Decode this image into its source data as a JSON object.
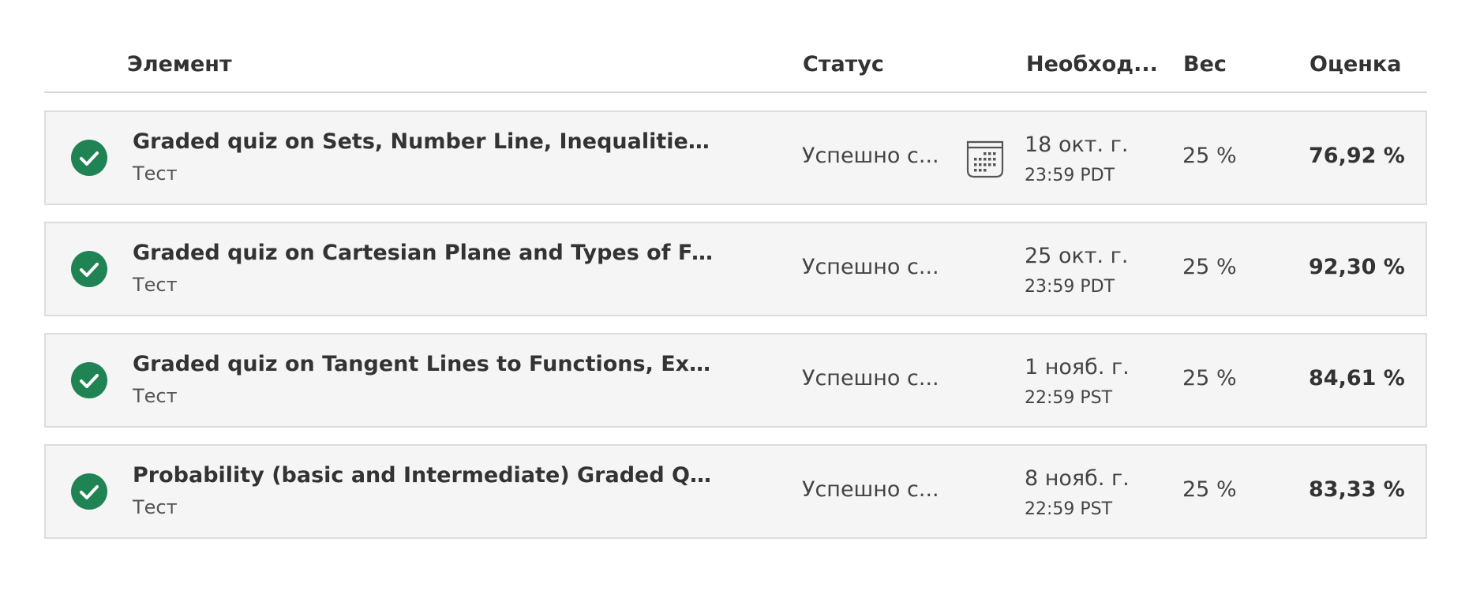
{
  "header": {
    "item": "Элемент",
    "status": "Статус",
    "due": "Необход...",
    "weight": "Вес",
    "grade": "Оценка"
  },
  "colors": {
    "check_green": "#1f8354",
    "row_bg": "#f5f5f5",
    "row_border": "#dddddd"
  },
  "rows": [
    {
      "icon": "check-circle-icon",
      "title": "Graded quiz on Sets, Number Line, Inequalities, Si...",
      "type": "Тест",
      "status": "Успешно с...",
      "calendar_icon": "calendar-icon",
      "due_date": "18 окт. г.",
      "due_time": "23:59 PDT",
      "weight": "25 %",
      "grade": "76,92 %"
    },
    {
      "icon": "check-circle-icon",
      "title": "Graded quiz on Cartesian Plane and Types of Funct...",
      "type": "Тест",
      "status": "Успешно с...",
      "due_date": "25 окт. г.",
      "due_time": "23:59 PDT",
      "weight": "25 %",
      "grade": "92,30 %"
    },
    {
      "icon": "check-circle-icon",
      "title": "Graded quiz on Tangent Lines to Functions, Expone...",
      "type": "Тест",
      "status": "Успешно с...",
      "due_date": "1 нояб. г.",
      "due_time": "22:59 PST",
      "weight": "25 %",
      "grade": "84,61 %"
    },
    {
      "icon": "check-circle-icon",
      "title": "Probability (basic and Intermediate) Graded Quiz",
      "type": "Тест",
      "status": "Успешно с...",
      "due_date": "8 нояб. г.",
      "due_time": "22:59 PST",
      "weight": "25 %",
      "grade": "83,33 %"
    }
  ]
}
